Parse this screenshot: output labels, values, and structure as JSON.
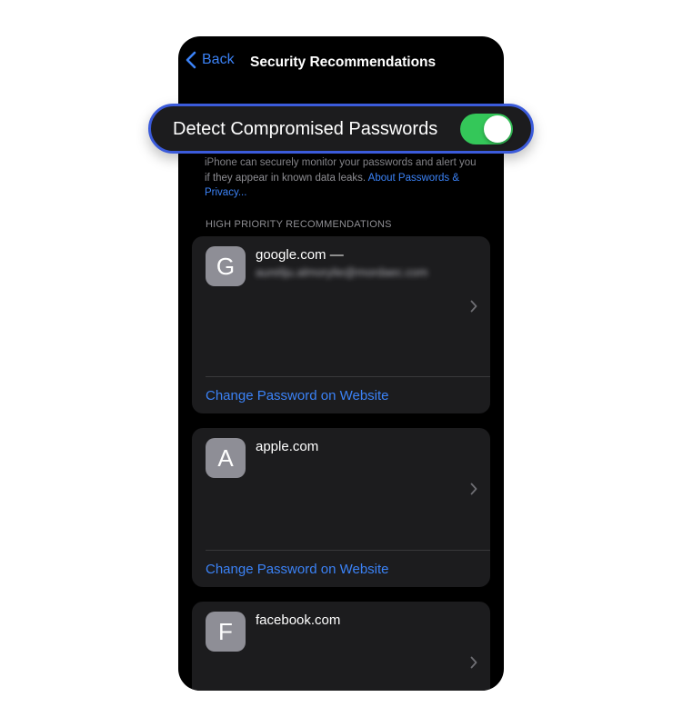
{
  "nav": {
    "back_label": "Back",
    "title": "Security Recommendations"
  },
  "setting": {
    "label": "Detect Compromised Passwords",
    "enabled": true,
    "description": "iPhone can securely monitor your passwords and alert you if they appear in known data leaks.",
    "link": "About Passwords & Privacy..."
  },
  "section_header": "HIGH PRIORITY RECOMMENDATIONS",
  "recommendations": [
    {
      "letter": "G",
      "site": "google.com —",
      "account": "aureliju.almorylie@mordaec.com",
      "action": "Change Password on Website"
    },
    {
      "letter": "A",
      "site": "apple.com",
      "action": "Change Password on Website"
    },
    {
      "letter": "F",
      "site": "facebook.com"
    }
  ],
  "colors": {
    "accent": "#3b82f6",
    "toggle_on": "#34c759",
    "highlight_border": "#3b5bdb",
    "card_bg": "#1c1c1e"
  },
  "icons": {
    "back": "chevron-left-icon",
    "row_disclosure": "chevron-right-icon"
  }
}
